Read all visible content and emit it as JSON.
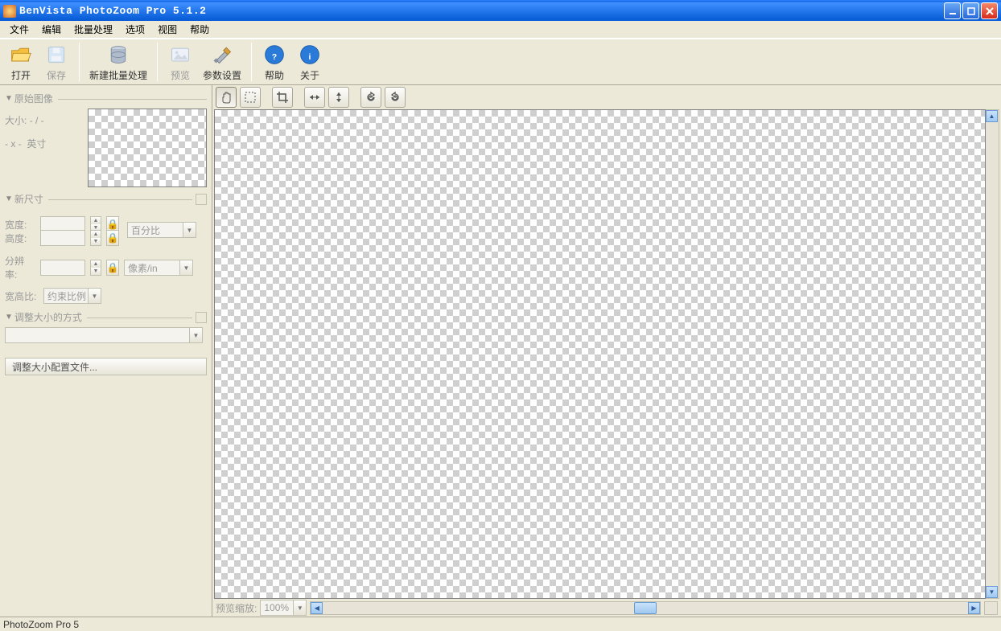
{
  "window": {
    "title": "BenVista PhotoZoom Pro 5.1.2"
  },
  "menu": {
    "file": "文件",
    "edit": "编辑",
    "batch": "批量处理",
    "options": "选项",
    "view": "视图",
    "help": "帮助"
  },
  "toolbar": {
    "open": "打开",
    "save": "保存",
    "newbatch": "新建批量处理",
    "preview": "预览",
    "settings": "参数设置",
    "help": "帮助",
    "about": "关于"
  },
  "leftPanel": {
    "originalHeader": "原始图像",
    "sizeLabel": "大小:",
    "sizeValue": "- / -",
    "dimValue": "- x -",
    "unit": "英寸",
    "newSizeHeader": "新尺寸",
    "widthLabel": "宽度:",
    "heightLabel": "高度:",
    "percentOption": "百分比",
    "resolutionLabel": "分辨率:",
    "resUnitOption": "像素/in",
    "aspectLabel": "宽高比:",
    "aspectOption": "约束比例",
    "resizeMethodHeader": "调整大小的方式",
    "presetButton": "调整大小配置文件..."
  },
  "previewBar": {
    "zoomLabel": "预览缩放:",
    "zoomValue": "100%"
  },
  "status": {
    "text": "PhotoZoom Pro 5"
  }
}
